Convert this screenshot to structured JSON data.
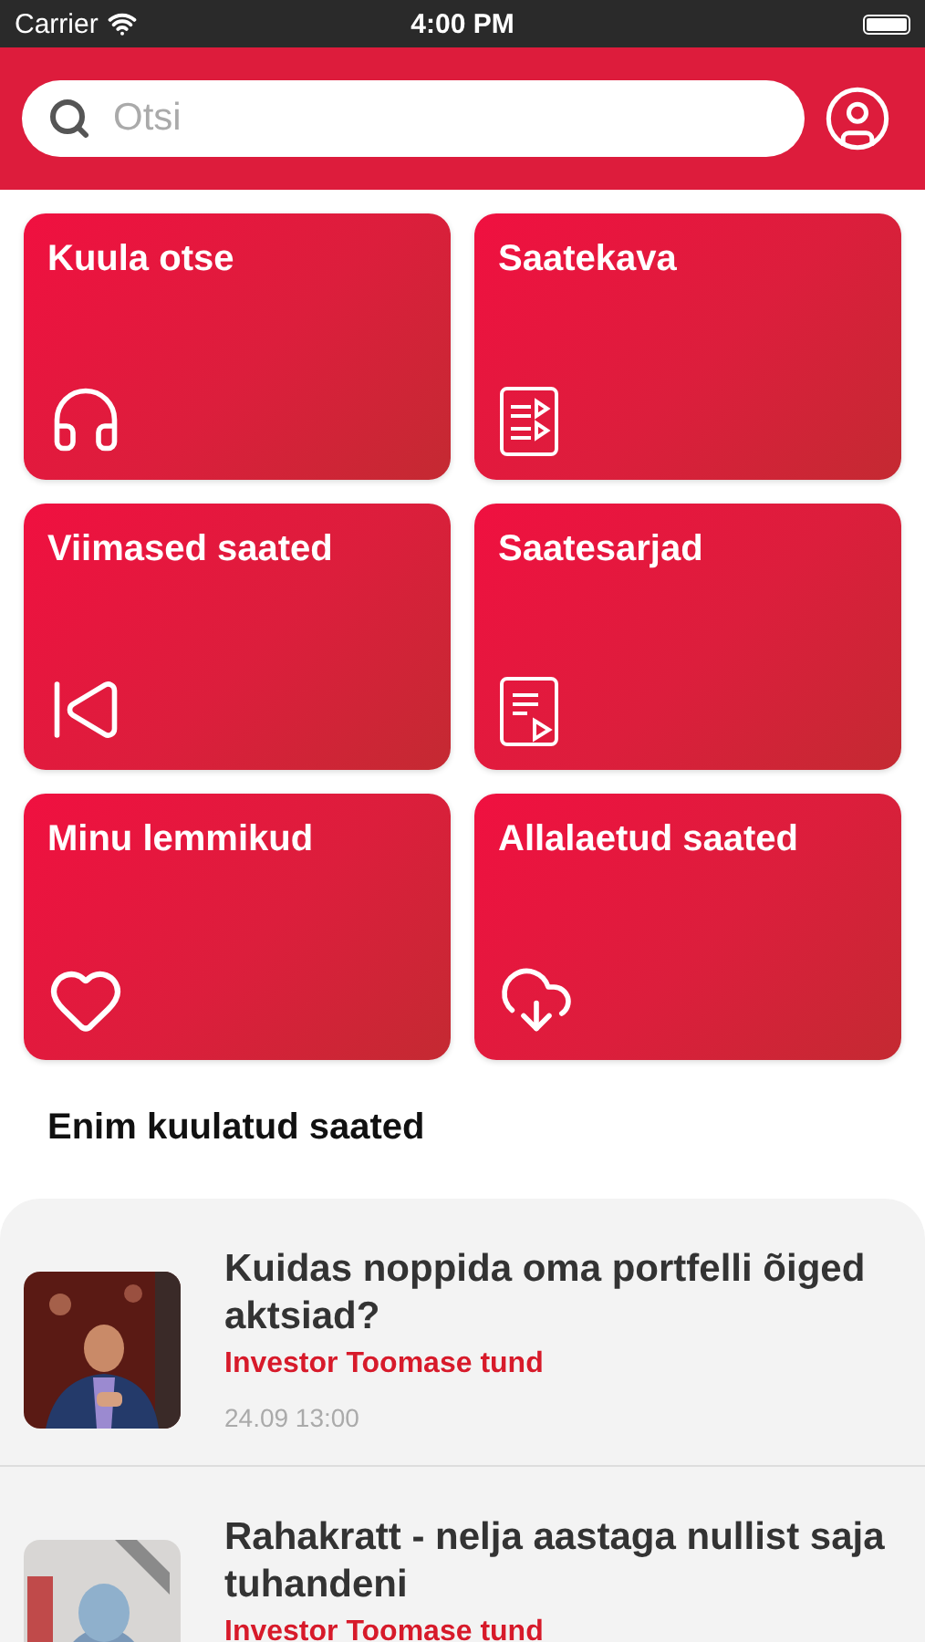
{
  "status_bar": {
    "carrier": "Carrier",
    "time": "4:00 PM"
  },
  "search": {
    "placeholder": "Otsi"
  },
  "tiles": [
    {
      "label": "Kuula otse",
      "kind": "headphones"
    },
    {
      "label": "Saatekava",
      "kind": "schedule"
    },
    {
      "label": "Viimased saated",
      "kind": "previous"
    },
    {
      "label": "Saatesarjad",
      "kind": "series"
    },
    {
      "label": "Minu lemmikud",
      "kind": "favorites"
    },
    {
      "label": "Allalaetud saated",
      "kind": "downloads"
    }
  ],
  "section_title": "Enim kuulatud saated",
  "episodes": [
    {
      "title": "Kuidas noppida oma portfelli õiged aktsiad?",
      "show": "Investor Toomase tund",
      "date": "24.09 13:00"
    },
    {
      "title": "Rahakratt - nelja aastaga nullist saja tuhandeni",
      "show": "Investor Toomase tund"
    }
  ]
}
